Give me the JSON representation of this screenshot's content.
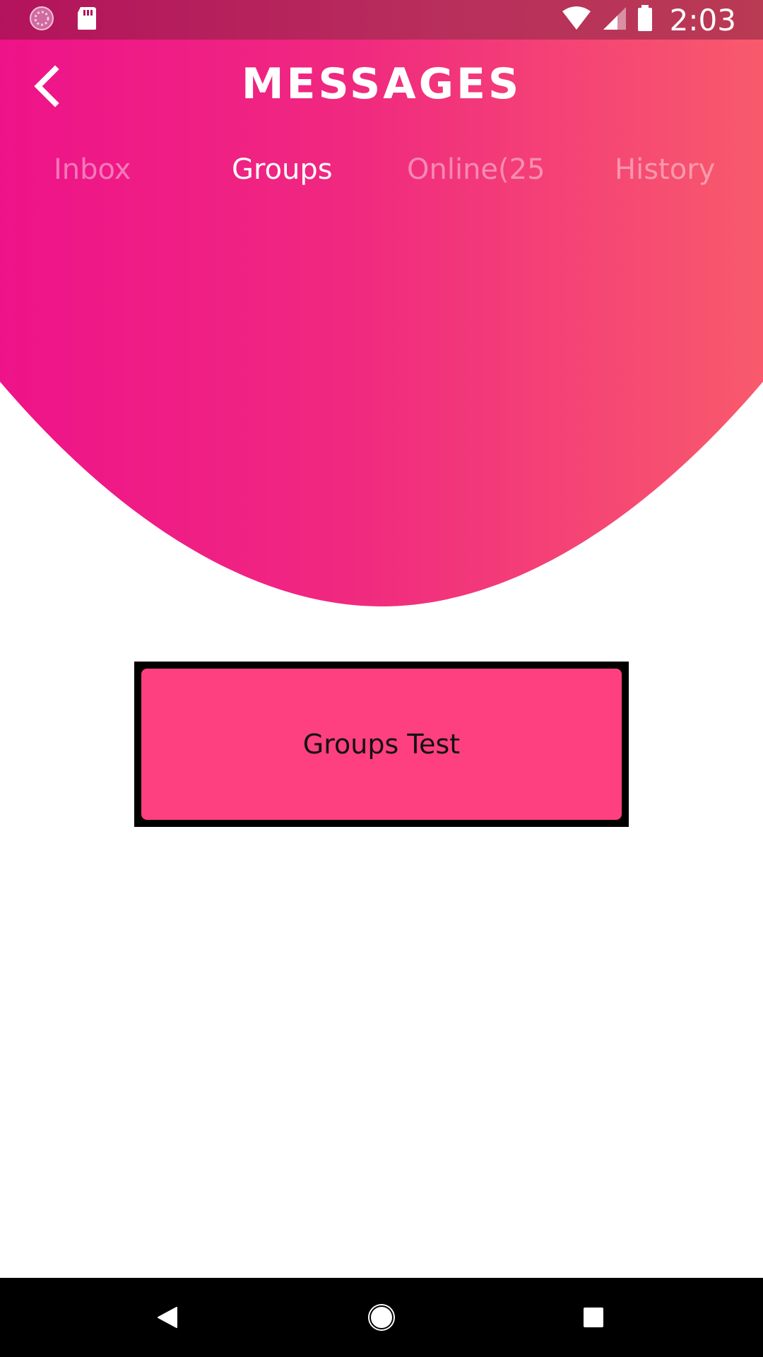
{
  "status_bar": {
    "time": "2:03",
    "left_icons": [
      "sync-icon",
      "sd-card-icon"
    ],
    "right_icons": [
      "wifi-icon",
      "signal-icon",
      "battery-icon"
    ]
  },
  "header": {
    "title": "MESSAGES",
    "back_icon": "chevron-left-icon",
    "gradient_colors": [
      "#ee1389",
      "#f85a6c"
    ]
  },
  "tabs": [
    {
      "label": "Inbox",
      "active": false
    },
    {
      "label": "Groups",
      "active": true
    },
    {
      "label": "Online(25",
      "active": false
    },
    {
      "label": "History",
      "active": false
    }
  ],
  "groups": [
    {
      "name": "Groups Test",
      "color": "#fe3f80"
    }
  ],
  "nav_bar": {
    "buttons": [
      "back-triangle-icon",
      "home-circle-icon",
      "recents-square-icon"
    ]
  }
}
